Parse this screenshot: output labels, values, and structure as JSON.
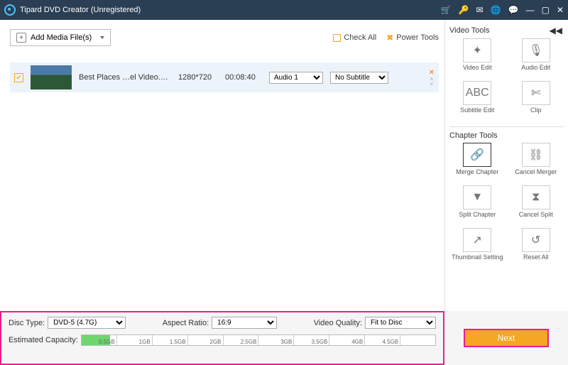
{
  "titlebar": {
    "title": "Tipard DVD Creator (Unregistered)"
  },
  "toolbar": {
    "add_label": "Add Media File(s)",
    "check_all": "Check All",
    "power_tools": "Power Tools"
  },
  "media": {
    "items": [
      {
        "filename": "Best Places …el Video.wmv",
        "resolution": "1280*720",
        "duration": "00:08:40",
        "audio": "Audio 1",
        "subtitle": "No Subtitle"
      }
    ]
  },
  "video_tools": {
    "header": "Video Tools",
    "items": [
      {
        "icon": "✦",
        "label": "Video Edit"
      },
      {
        "icon": "🎙",
        "label": "Audio Edit"
      },
      {
        "icon": "ABC",
        "label": "Subtitle Edit"
      },
      {
        "icon": "✄",
        "label": "Clip"
      }
    ]
  },
  "chapter_tools": {
    "header": "Chapter Tools",
    "items": [
      {
        "icon": "🔗",
        "label": "Merge Chapter",
        "selected": true
      },
      {
        "icon": "⛓",
        "label": "Cancel Merger"
      },
      {
        "icon": "▼",
        "label": "Split Chapter"
      },
      {
        "icon": "⧗",
        "label": "Cancel Split"
      },
      {
        "icon": "↗",
        "label": "Thumbnail Setting"
      },
      {
        "icon": "↺",
        "label": "Reset All"
      }
    ]
  },
  "bottom": {
    "disc_type_label": "Disc Type:",
    "disc_type": "DVD-5 (4.7G)",
    "aspect_label": "Aspect Ratio:",
    "aspect": "16:9",
    "quality_label": "Video Quality:",
    "quality": "Fit to Disc",
    "capacity_label": "Estimated Capacity:",
    "ticks": [
      "0.5GB",
      "1GB",
      "1.5GB",
      "2GB",
      "2.5GB",
      "3GB",
      "3.5GB",
      "4GB",
      "4.5GB",
      ""
    ]
  },
  "next_label": "Next"
}
